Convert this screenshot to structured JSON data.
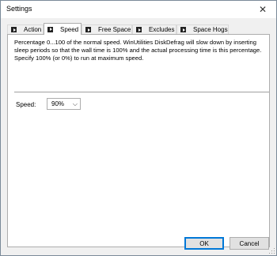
{
  "window": {
    "title": "Settings",
    "close_glyph": "✕"
  },
  "tabs": [
    {
      "label": "Action",
      "icon": "play-square-icon",
      "active": false
    },
    {
      "label": "Speed",
      "icon": "play-square-icon",
      "active": true
    },
    {
      "label": "Free Space",
      "icon": "play-square-icon",
      "active": false
    },
    {
      "label": "Excludes",
      "icon": "play-square-icon",
      "active": false
    },
    {
      "label": "Space Hogs",
      "icon": "play-square-icon",
      "active": false
    }
  ],
  "speed_panel": {
    "description": "Percentage 0...100 of the normal speed. WinUtilities DiskDefrag will slow down by inserting sleep periods so that the wall time is 100% and the actual processing time is this percentage. Specify 100% (or 0%) to run at maximum speed.",
    "speed_label": "Speed:",
    "speed_value": "90%",
    "chevron_glyph": "⌵"
  },
  "buttons": {
    "ok": "OK",
    "cancel": "Cancel"
  },
  "colors": {
    "accent": "#0078d7",
    "panel_background": "#ffffff",
    "dialog_background": "#f0f0f0"
  }
}
